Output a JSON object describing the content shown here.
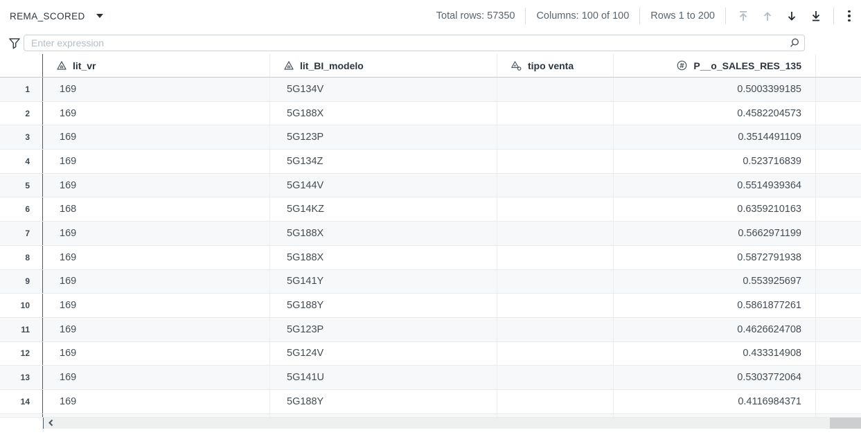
{
  "topbar": {
    "dataset_name": "REMA_SCORED",
    "total_rows": {
      "label": "Total rows:",
      "value": "57350"
    },
    "columns_info": {
      "label": "Columns:",
      "value": "100 of 100"
    },
    "rows_info": {
      "label": "Rows",
      "value": "1 to 200"
    },
    "icons": [
      "scroll-to-top",
      "scroll-up",
      "scroll-down",
      "scroll-to-bottom",
      "more-options"
    ]
  },
  "filter": {
    "placeholder": "Enter expression"
  },
  "table": {
    "columns": [
      {
        "label": "lit_vr",
        "type_icon": "triangle-type-icon",
        "align": "left"
      },
      {
        "label": "lit_BI_modelo",
        "type_icon": "triangle-type-icon",
        "align": "left"
      },
      {
        "label": "tipo venta",
        "type_icon": "triangle-circle-type-icon",
        "align": "left"
      },
      {
        "label": "P__o_SALES_RES_135",
        "type_icon": "hash-circle-type-icon",
        "align": "right"
      }
    ],
    "rows": [
      [
        "1",
        "169",
        "5G134V",
        "",
        "0.5003399185"
      ],
      [
        "2",
        "169",
        "5G188X",
        "",
        "0.4582204573"
      ],
      [
        "3",
        "169",
        "5G123P",
        "",
        "0.3514491109"
      ],
      [
        "4",
        "169",
        "5G134Z",
        "",
        "0.523716839"
      ],
      [
        "5",
        "169",
        "5G144V",
        "",
        "0.5514939364"
      ],
      [
        "6",
        "168",
        "5G14KZ",
        "",
        "0.6359210163"
      ],
      [
        "7",
        "169",
        "5G188X",
        "",
        "0.5662971199"
      ],
      [
        "8",
        "169",
        "5G188X",
        "",
        "0.5872791938"
      ],
      [
        "9",
        "169",
        "5G141Y",
        "",
        "0.553925697"
      ],
      [
        "10",
        "169",
        "5G188Y",
        "",
        "0.5861877261"
      ],
      [
        "11",
        "169",
        "5G123P",
        "",
        "0.4626624708"
      ],
      [
        "12",
        "169",
        "5G124V",
        "",
        "0.433314908"
      ],
      [
        "13",
        "169",
        "5G141U",
        "",
        "0.5303772064"
      ],
      [
        "14",
        "169",
        "5G188Y",
        "",
        "0.4116984371"
      ]
    ]
  },
  "colors": {
    "accent_line": "#4a5662",
    "row_stripe": "#f7f8f9",
    "disabled_icon": "#b4bdc4",
    "enabled_icon": "#22282d"
  }
}
